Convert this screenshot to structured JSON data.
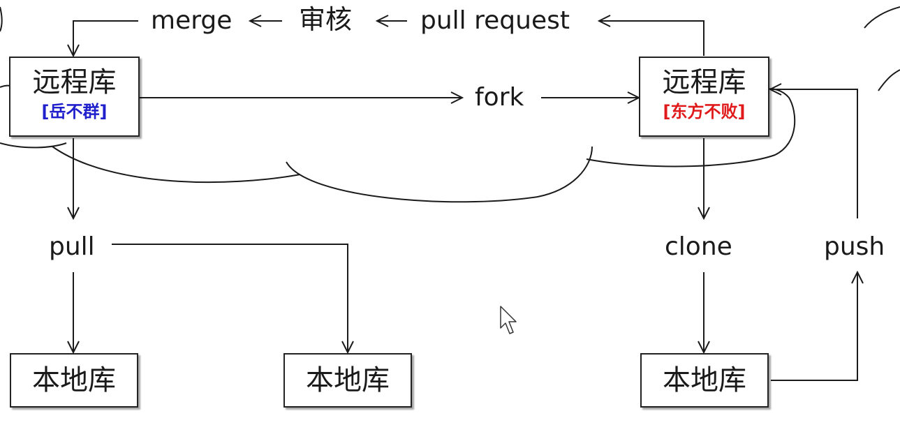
{
  "diagram": {
    "top_flow": {
      "merge": "merge",
      "review": "审核",
      "pull_request": "pull request"
    },
    "fork": "fork",
    "pull": "pull",
    "clone": "clone",
    "push": "push",
    "remote_left": {
      "title": "远程库",
      "owner": "[岳不群]",
      "owner_color": "#1f1fcc"
    },
    "remote_right": {
      "title": "远程库",
      "owner": "[东方不败]",
      "owner_color": "#e01a1a"
    },
    "local_left": {
      "title": "本地库"
    },
    "local_middle": {
      "title": "本地库"
    },
    "local_right": {
      "title": "本地库"
    }
  }
}
